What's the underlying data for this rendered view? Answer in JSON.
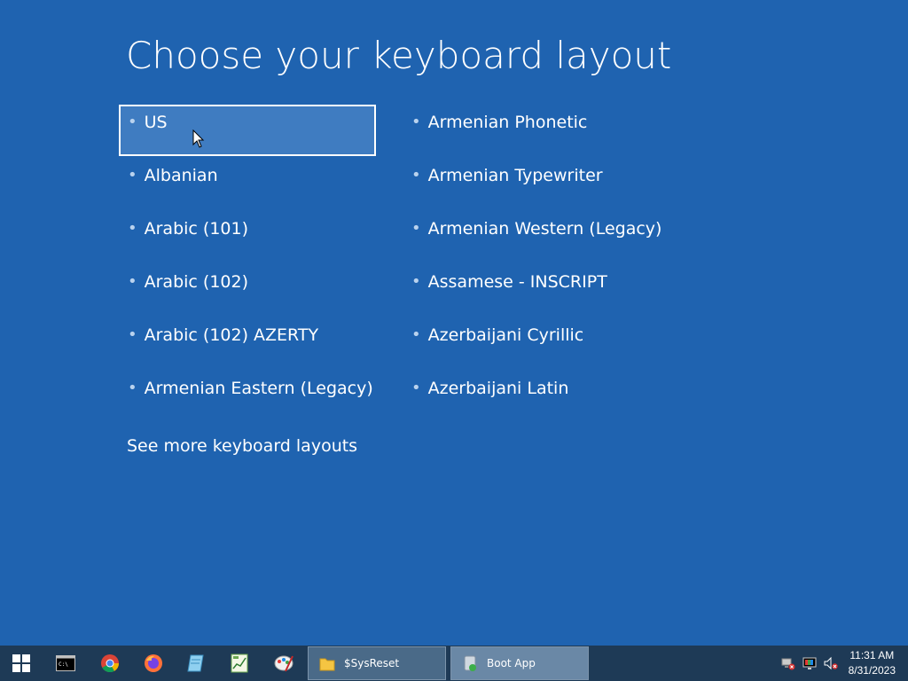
{
  "page": {
    "title": "Choose your keyboard layout",
    "layouts_left": [
      "US",
      "Albanian",
      "Arabic (101)",
      "Arabic (102)",
      "Arabic (102) AZERTY",
      "Armenian Eastern (Legacy)"
    ],
    "layouts_right": [
      "Armenian Phonetic",
      "Armenian Typewriter",
      "Armenian Western (Legacy)",
      "Assamese - INSCRIPT",
      "Azerbaijani Cyrillic",
      "Azerbaijani Latin"
    ],
    "selected": "US",
    "more_link": "See more keyboard layouts"
  },
  "taskbar": {
    "pinned": [
      "windows-start-icon",
      "command-prompt-icon",
      "chrome-icon",
      "firefox-icon",
      "notepad-icon",
      "spreadsheet-icon",
      "paint-icon"
    ],
    "tasks": [
      {
        "label": "$SysReset",
        "icon": "folder-icon",
        "active": false
      },
      {
        "label": "Boot App",
        "icon": "app-icon",
        "active": true
      }
    ],
    "clock_time": "11:31 AM",
    "clock_date": "8/31/2023"
  },
  "colors": {
    "background": "#1f63b0",
    "selection": "#3f7cc1",
    "taskbar": "#1e3a56"
  }
}
